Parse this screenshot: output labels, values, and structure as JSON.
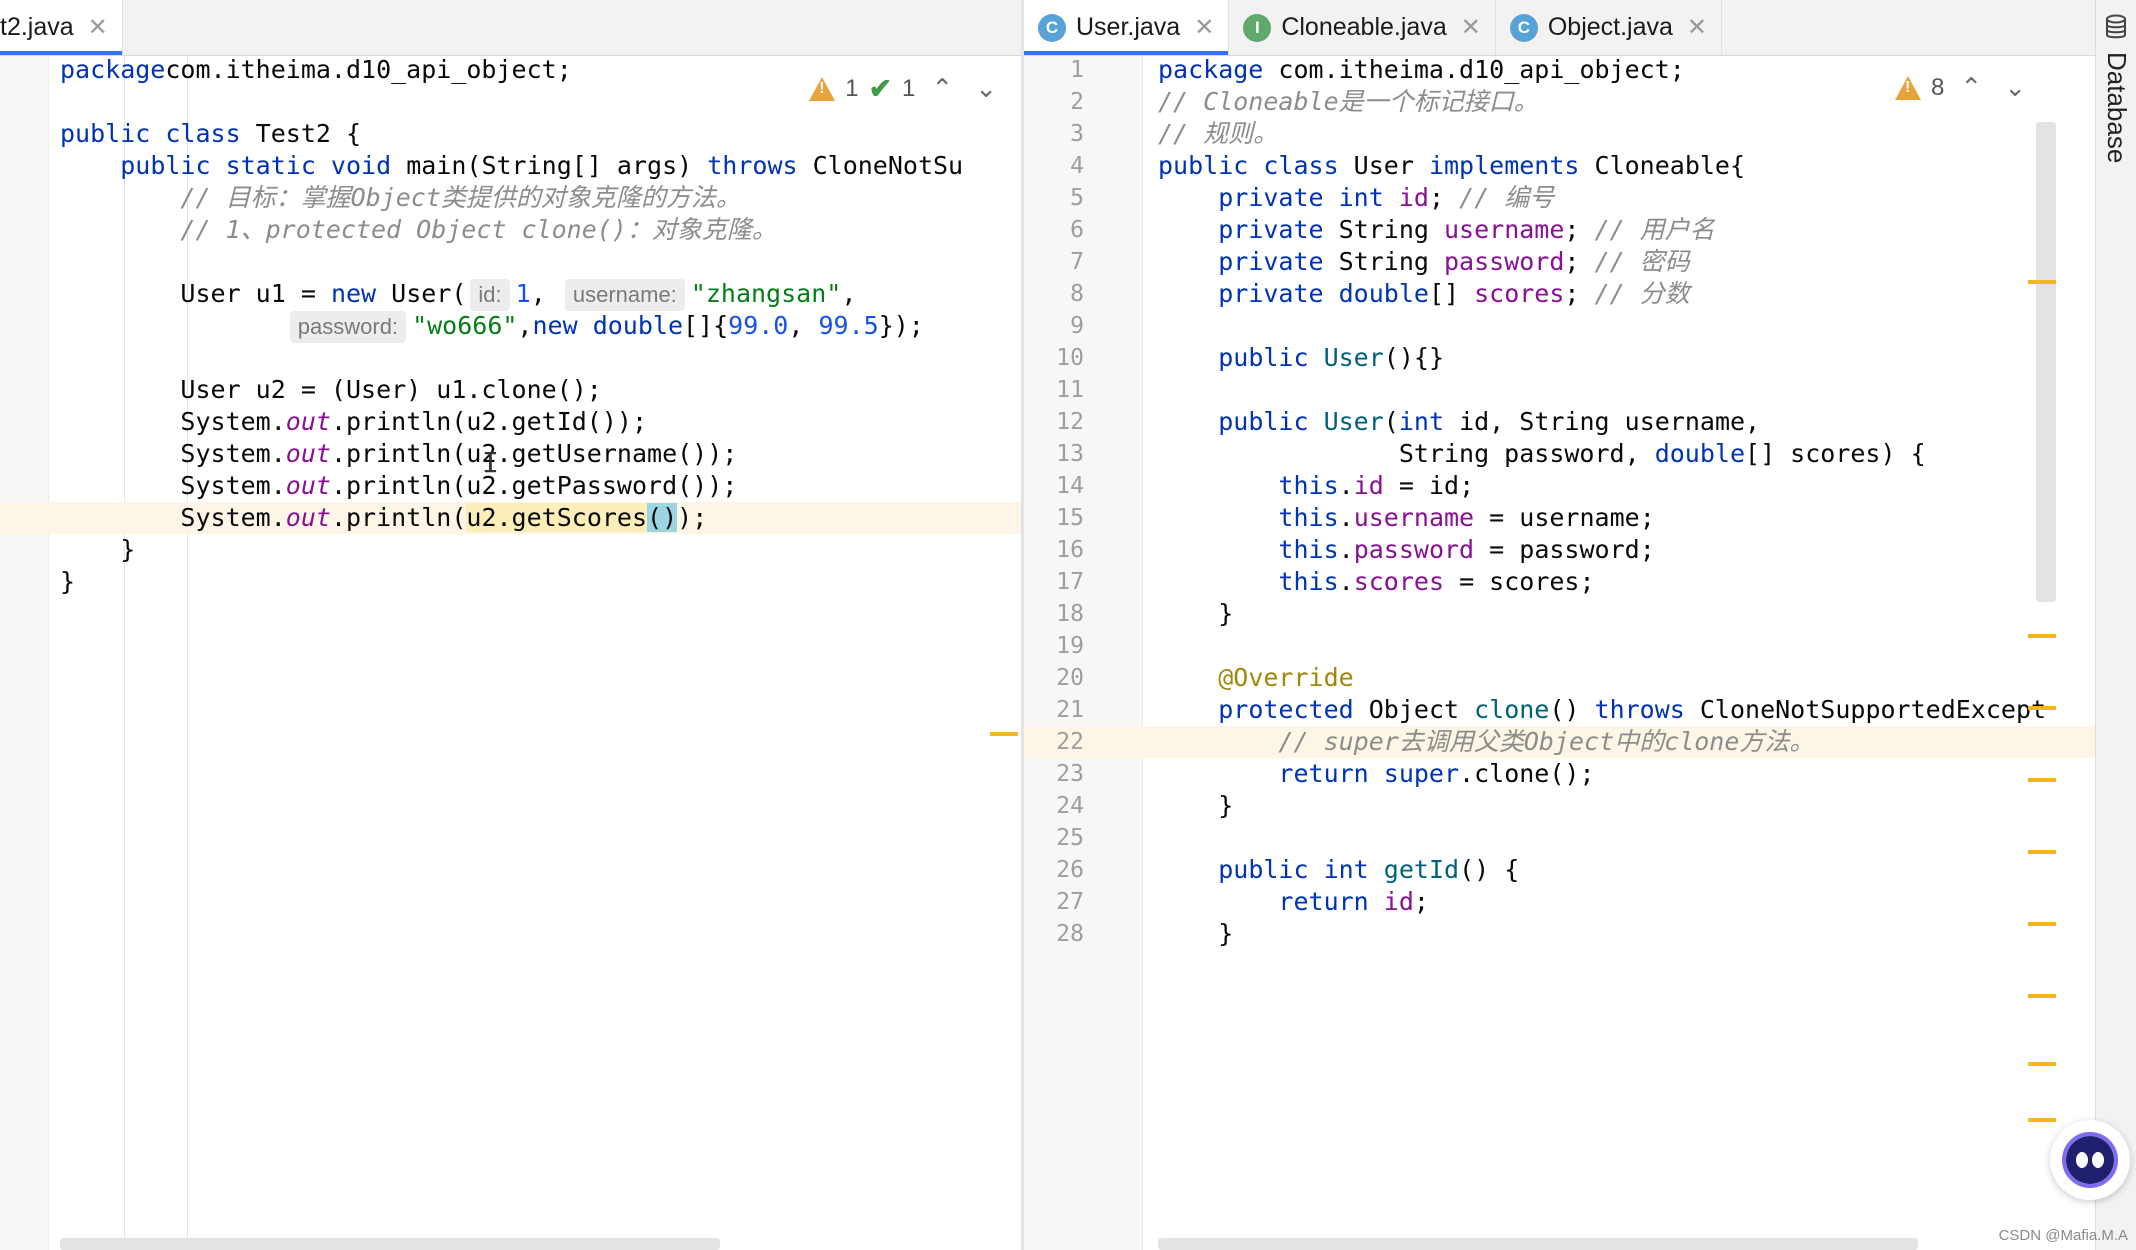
{
  "left_tab": {
    "label": "t2.java"
  },
  "right_tabs": [
    {
      "label": "User.java",
      "icon": "C",
      "icon_type": "class",
      "active": true
    },
    {
      "label": "Cloneable.java",
      "icon": "I",
      "icon_type": "interface",
      "active": false
    },
    {
      "label": "Object.java",
      "icon": "C",
      "icon_type": "class",
      "active": false
    }
  ],
  "tab_close": "✕",
  "left_editor": {
    "inspection": {
      "warnings": "1",
      "weak_warnings": "1"
    },
    "lines": [
      {
        "parts": [
          [
            "kw",
            "package"
          ],
          [
            "",
            "com.itheima.d10_api_object;"
          ]
        ]
      },
      {
        "parts": []
      },
      {
        "parts": [
          [
            "kw",
            "public class "
          ],
          [
            "",
            "Test2 {"
          ]
        ]
      },
      {
        "parts": [
          [
            "",
            "    "
          ],
          [
            "kw",
            "public static void "
          ],
          [
            "",
            "main(String[] args) "
          ],
          [
            "kw",
            "throws "
          ],
          [
            "",
            "CloneNotSu"
          ]
        ]
      },
      {
        "parts": [
          [
            "",
            "        "
          ],
          [
            "cm",
            "// 目标：掌握Object类提供的对象克隆的方法。"
          ]
        ]
      },
      {
        "parts": [
          [
            "",
            "        "
          ],
          [
            "cm",
            "// 1、protected Object clone()：对象克隆。"
          ]
        ]
      },
      {
        "parts": []
      },
      {
        "parts": [
          [
            "",
            "        User u1 = "
          ],
          [
            "kw",
            "new "
          ],
          [
            "",
            "User("
          ],
          [
            "hint",
            "id:"
          ],
          [
            "num",
            "1"
          ],
          [
            "",
            ", "
          ],
          [
            "hint",
            "username:"
          ],
          [
            "str",
            "\"zhangsan\""
          ],
          [
            "",
            ","
          ]
        ]
      },
      {
        "parts": [
          [
            "",
            "               "
          ],
          [
            "hint",
            "password:"
          ],
          [
            "str",
            "\"wo666\""
          ],
          [
            "",
            ","
          ],
          [
            "kw",
            "new double"
          ],
          [
            "",
            "[]{"
          ],
          [
            "num",
            "99.0"
          ],
          [
            "",
            ", "
          ],
          [
            "num",
            "99.5"
          ],
          [
            "",
            "});"
          ]
        ]
      },
      {
        "parts": []
      },
      {
        "parts": [
          [
            "",
            "        User u2 = (User) u1.clone();"
          ]
        ]
      },
      {
        "parts": [
          [
            "",
            "        System."
          ],
          [
            "itl",
            "out"
          ],
          [
            "",
            ".println(u2.getId());"
          ]
        ]
      },
      {
        "parts": [
          [
            "",
            "        System."
          ],
          [
            "itl",
            "out"
          ],
          [
            "",
            ".println(u2.getUsername());"
          ]
        ]
      },
      {
        "parts": [
          [
            "",
            "        System."
          ],
          [
            "itl",
            "out"
          ],
          [
            "",
            ".println(u2.getPassword());"
          ]
        ]
      },
      {
        "parts": [
          [
            "",
            "        System."
          ],
          [
            "itl",
            "out"
          ],
          [
            "",
            ".println("
          ],
          [
            "usage",
            "u2.getScores"
          ],
          [
            "caret-hl",
            "()"
          ],
          [
            "",
            ");"
          ]
        ],
        "highlight": true
      },
      {
        "parts": [
          [
            "",
            "    }"
          ]
        ]
      },
      {
        "parts": [
          [
            "",
            "}"
          ]
        ]
      }
    ]
  },
  "right_editor": {
    "inspection": {
      "warnings": "8"
    },
    "lines": [
      {
        "n": "1",
        "parts": [
          [
            "kw",
            "package "
          ],
          [
            "",
            "com.itheima.d10_api_object;"
          ]
        ]
      },
      {
        "n": "2",
        "parts": [
          [
            "cm",
            "// Cloneable是一个标记接口。"
          ]
        ]
      },
      {
        "n": "3",
        "parts": [
          [
            "cm",
            "// 规则。"
          ]
        ]
      },
      {
        "n": "4",
        "parts": [
          [
            "kw",
            "public class "
          ],
          [
            "",
            "User "
          ],
          [
            "kw",
            "implements "
          ],
          [
            "",
            "Cloneable{"
          ]
        ]
      },
      {
        "n": "5",
        "parts": [
          [
            "",
            "    "
          ],
          [
            "kw",
            "private int "
          ],
          [
            "fld",
            "id"
          ],
          [
            "",
            "; "
          ],
          [
            "cm",
            "// 编号"
          ]
        ]
      },
      {
        "n": "6",
        "parts": [
          [
            "",
            "    "
          ],
          [
            "kw",
            "private "
          ],
          [
            "",
            "String "
          ],
          [
            "fld",
            "username"
          ],
          [
            "",
            "; "
          ],
          [
            "cm",
            "// 用户名"
          ]
        ]
      },
      {
        "n": "7",
        "parts": [
          [
            "",
            "    "
          ],
          [
            "kw",
            "private "
          ],
          [
            "",
            "String "
          ],
          [
            "fld",
            "password"
          ],
          [
            "",
            "; "
          ],
          [
            "cm",
            "// 密码"
          ]
        ]
      },
      {
        "n": "8",
        "parts": [
          [
            "",
            "    "
          ],
          [
            "kw",
            "private double"
          ],
          [
            "",
            "[] "
          ],
          [
            "fld",
            "scores"
          ],
          [
            "",
            "; "
          ],
          [
            "cm",
            "// 分数"
          ]
        ]
      },
      {
        "n": "9",
        "parts": []
      },
      {
        "n": "10",
        "parts": [
          [
            "",
            "    "
          ],
          [
            "kw",
            "public "
          ],
          [
            "fn",
            "User"
          ],
          [
            "",
            "(){}"
          ]
        ]
      },
      {
        "n": "11",
        "parts": []
      },
      {
        "n": "12",
        "parts": [
          [
            "",
            "    "
          ],
          [
            "kw",
            "public "
          ],
          [
            "fn",
            "User"
          ],
          [
            "",
            "("
          ],
          [
            "kw",
            "int "
          ],
          [
            "",
            "id, String username,"
          ]
        ]
      },
      {
        "n": "13",
        "parts": [
          [
            "",
            "                String password, "
          ],
          [
            "kw",
            "double"
          ],
          [
            "",
            "[] scores) {"
          ]
        ]
      },
      {
        "n": "14",
        "parts": [
          [
            "",
            "        "
          ],
          [
            "kw",
            "this"
          ],
          [
            "",
            "."
          ],
          [
            "fld",
            "id"
          ],
          [
            "",
            " = id;"
          ]
        ]
      },
      {
        "n": "15",
        "parts": [
          [
            "",
            "        "
          ],
          [
            "kw",
            "this"
          ],
          [
            "",
            "."
          ],
          [
            "fld",
            "username"
          ],
          [
            "",
            " = username;"
          ]
        ]
      },
      {
        "n": "16",
        "parts": [
          [
            "",
            "        "
          ],
          [
            "kw",
            "this"
          ],
          [
            "",
            "."
          ],
          [
            "fld",
            "password"
          ],
          [
            "",
            " = password;"
          ]
        ]
      },
      {
        "n": "17",
        "parts": [
          [
            "",
            "        "
          ],
          [
            "kw",
            "this"
          ],
          [
            "",
            "."
          ],
          [
            "fld",
            "scores"
          ],
          [
            "",
            " = scores;"
          ]
        ]
      },
      {
        "n": "18",
        "parts": [
          [
            "",
            "    }"
          ]
        ]
      },
      {
        "n": "19",
        "parts": []
      },
      {
        "n": "20",
        "parts": [
          [
            "",
            "    "
          ],
          [
            "ann",
            "@Override"
          ]
        ]
      },
      {
        "n": "21",
        "parts": [
          [
            "",
            "    "
          ],
          [
            "kw",
            "protected "
          ],
          [
            "",
            "Object "
          ],
          [
            "fn",
            "clone"
          ],
          [
            "",
            "() "
          ],
          [
            "kw",
            "throws "
          ],
          [
            "",
            "CloneNotSupportedExcept"
          ]
        ]
      },
      {
        "n": "22",
        "parts": [
          [
            "",
            "        "
          ],
          [
            "cm",
            "// super去调用父类Object中的clone方法。"
          ]
        ],
        "highlight": true
      },
      {
        "n": "23",
        "parts": [
          [
            "",
            "        "
          ],
          [
            "kw",
            "return super"
          ],
          [
            "",
            ".clone();"
          ]
        ]
      },
      {
        "n": "24",
        "parts": [
          [
            "",
            "    }"
          ]
        ]
      },
      {
        "n": "25",
        "parts": []
      },
      {
        "n": "26",
        "parts": [
          [
            "",
            "    "
          ],
          [
            "kw",
            "public int "
          ],
          [
            "fn",
            "getId"
          ],
          [
            "",
            "() {"
          ]
        ]
      },
      {
        "n": "27",
        "parts": [
          [
            "",
            "        "
          ],
          [
            "kw",
            "return "
          ],
          [
            "fld",
            "id"
          ],
          [
            "",
            ";"
          ]
        ]
      },
      {
        "n": "28",
        "parts": [
          [
            "",
            "    }"
          ]
        ]
      }
    ]
  },
  "tool_window": {
    "label": "Database"
  },
  "watermark": "CSDN @Mafia.M.A",
  "colors": {
    "accent": "#3574f0",
    "warning": "#e8a33d",
    "marker": "#f2b620"
  }
}
